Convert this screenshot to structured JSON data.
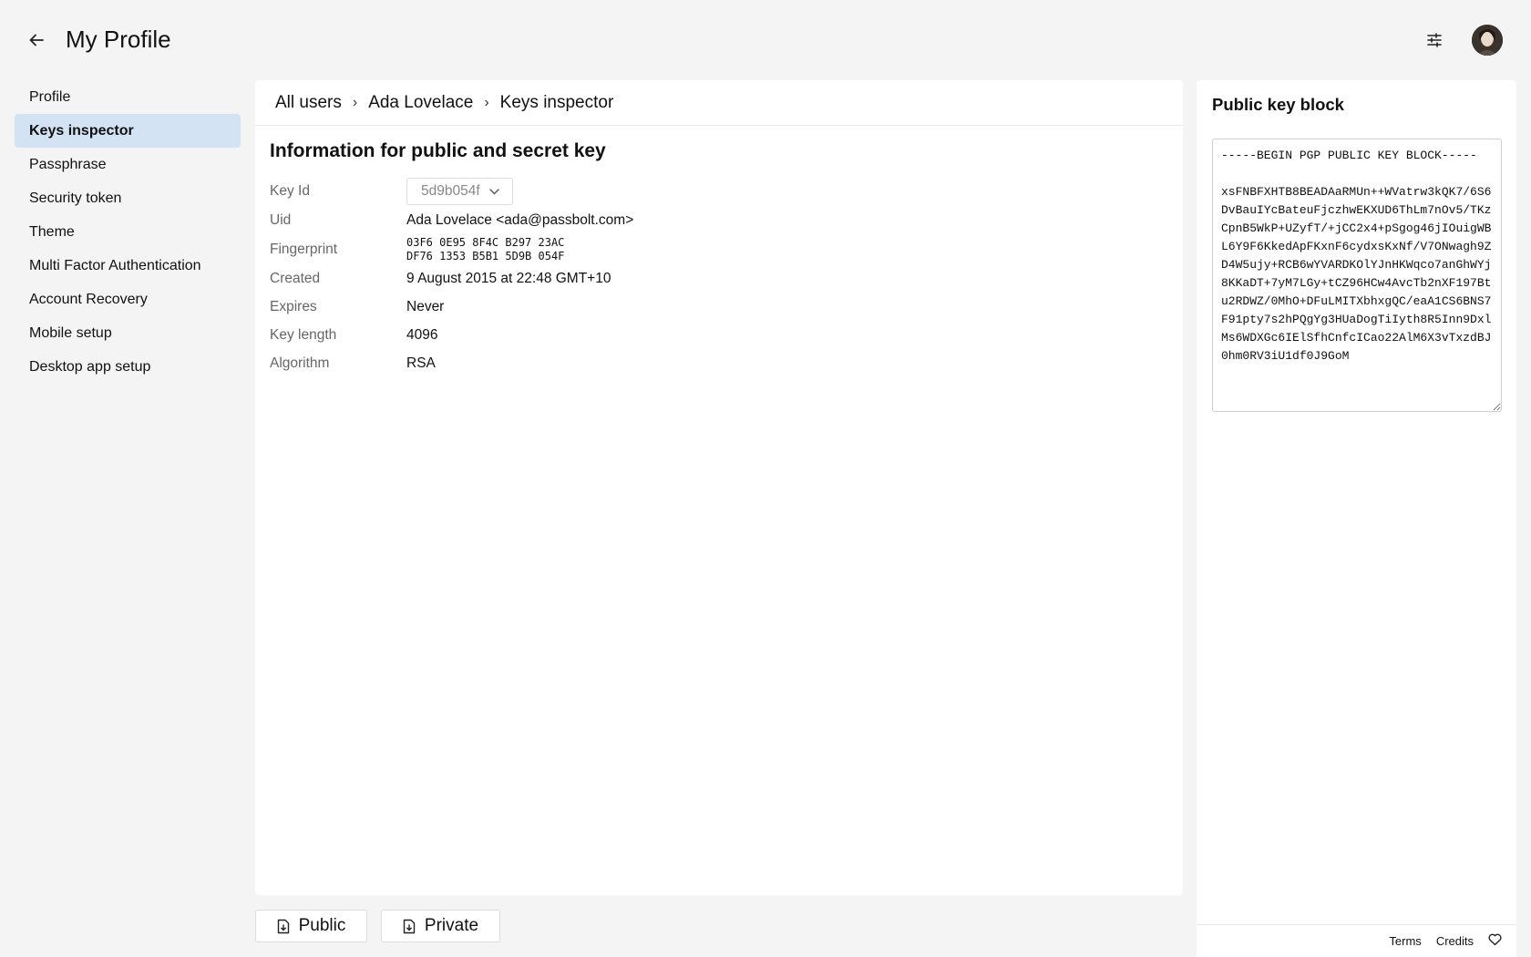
{
  "header": {
    "title": "My Profile",
    "back_icon": "arrow-left-icon",
    "filter_icon": "sliders-icon"
  },
  "sidebar": {
    "items": [
      {
        "label": "Profile",
        "active": false
      },
      {
        "label": "Keys inspector",
        "active": true
      },
      {
        "label": "Passphrase",
        "active": false
      },
      {
        "label": "Security token",
        "active": false
      },
      {
        "label": "Theme",
        "active": false
      },
      {
        "label": "Multi Factor Authentication",
        "active": false
      },
      {
        "label": "Account Recovery",
        "active": false
      },
      {
        "label": "Mobile setup",
        "active": false
      },
      {
        "label": "Desktop app setup",
        "active": false
      }
    ]
  },
  "breadcrumb": {
    "items": [
      "All users",
      "Ada Lovelace",
      "Keys inspector"
    ],
    "separator": "›"
  },
  "info": {
    "title": "Information for public and secret key",
    "key_id_label": "Key Id",
    "key_id_value": "5d9b054f",
    "uid_label": "Uid",
    "uid_value": "Ada Lovelace <ada@passbolt.com>",
    "fingerprint_label": "Fingerprint",
    "fingerprint_line1": "03F6 0E95 8F4C B297 23AC",
    "fingerprint_line2": "DF76 1353 B5B1 5D9B 054F",
    "created_label": "Created",
    "created_value": "9 August 2015 at 22:48 GMT+10",
    "expires_label": "Expires",
    "expires_value": "Never",
    "key_length_label": "Key length",
    "key_length_value": "4096",
    "algorithm_label": "Algorithm",
    "algorithm_value": "RSA"
  },
  "actions": {
    "public_label": "Public",
    "private_label": "Private"
  },
  "public_key": {
    "title": "Public key block",
    "content": "-----BEGIN PGP PUBLIC KEY BLOCK-----\n\nxsFNBFXHTB8BEADAaRMUn++WVatrw3kQK7/6S6DvBauIYcBateuFjczhwEKXUD6ThLm7nOv5/TKzCpnB5WkP+UZyfT/+jCC2x4+pSgog46jIOuigWBL6Y9F6KkedApFKxnF6cydxsKxNf/V7ONwagh9ZD4W5ujy+RCB6wYVARDKOlYJnHKWqco7anGhWYj8KKaDT+7yM7LGy+tCZ96HCw4AvcTb2nXF197Btu2RDWZ/0MhO+DFuLMITXbhxgQC/eaA1CS6BNS7F91pty7s2hPQgYg3HUaDogTiIyth8R5Inn9DxlMs6WDXGc6IElSfhCnfcICao22AlM6X3vTxzdBJ0hm0RV3iU1df0J9GoM"
  },
  "footer": {
    "terms": "Terms",
    "credits": "Credits",
    "heart_icon": "heart-icon"
  }
}
